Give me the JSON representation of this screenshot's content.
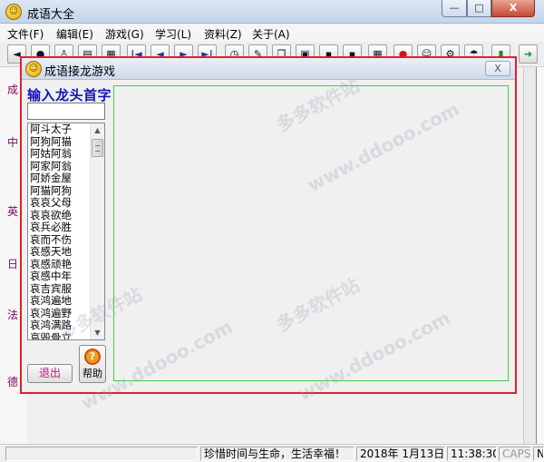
{
  "app": {
    "title": "成语大全",
    "window_controls": {
      "minimize": "—",
      "maximize": "□",
      "close": "X"
    }
  },
  "menu": {
    "items": [
      "文件(F)",
      "编辑(E)",
      "游戏(G)",
      "学习(L)",
      "资料(Z)",
      "关于(A)"
    ]
  },
  "toolbar": {
    "buttons": [
      {
        "icon": "back-icon",
        "glyph": "◄"
      },
      {
        "icon": "globe-icon",
        "glyph": "●"
      },
      {
        "icon": "person-icon",
        "glyph": "♙"
      },
      {
        "icon": "document-icon",
        "glyph": "▤"
      },
      {
        "icon": "book-icon",
        "glyph": "▦"
      },
      {
        "icon": "first-icon",
        "glyph": "|◄"
      },
      {
        "icon": "prev-icon",
        "glyph": "◄"
      },
      {
        "icon": "next-icon",
        "glyph": "►"
      },
      {
        "icon": "last-icon",
        "glyph": "►|"
      },
      {
        "icon": "clock-icon",
        "glyph": "◷"
      },
      {
        "icon": "edit-icon",
        "glyph": "✎"
      },
      {
        "icon": "copy-icon",
        "glyph": "❐"
      },
      {
        "icon": "paste-icon",
        "glyph": "▣"
      },
      {
        "icon": "gray-icon",
        "glyph": "▪"
      },
      {
        "icon": "gray-icon-2",
        "glyph": "▪"
      },
      {
        "icon": "calendar-icon",
        "glyph": "▦"
      },
      {
        "icon": "apple-icon",
        "glyph": "●"
      },
      {
        "icon": "smile-icon",
        "glyph": "☺"
      },
      {
        "icon": "gear-icon",
        "glyph": "⚙"
      },
      {
        "icon": "hat-icon",
        "glyph": "☂"
      },
      {
        "icon": "bookmark-icon",
        "glyph": "▮"
      },
      {
        "icon": "forward-icon",
        "glyph": "➜"
      }
    ]
  },
  "left_strip": {
    "labels": [
      "成",
      "中",
      "英",
      "日",
      "法",
      "德"
    ]
  },
  "dialog": {
    "title": "成语接龙游戏",
    "close_label": "X",
    "prompt": "输入龙头首字",
    "input_value": "",
    "idioms": [
      "阿斗太子",
      "阿狗阿猫",
      "阿姑阿翁",
      "阿家阿翁",
      "阿娇金屋",
      "阿猫阿狗",
      "哀哀父母",
      "哀哀欲绝",
      "哀兵必胜",
      "哀而不伤",
      "哀感天地",
      "哀感顽艳",
      "哀感中年",
      "哀吉宾服",
      "哀鸿遍地",
      "哀鸿遍野",
      "哀鸿满路",
      "哀毁骨立"
    ],
    "list_scroll_up": "▲",
    "list_scroll_down": "▼",
    "exit_label": "退出",
    "help_label": "帮助",
    "help_icon_glyph": "?"
  },
  "status": {
    "blank": "",
    "message": "珍惜时间与生命，生活幸福！",
    "date": "2018年 1月13日",
    "time": "11:38:30",
    "caps": "CAPS",
    "num": "N"
  },
  "watermarks": [
    "多多软件站",
    "www.ddooo.com"
  ]
}
